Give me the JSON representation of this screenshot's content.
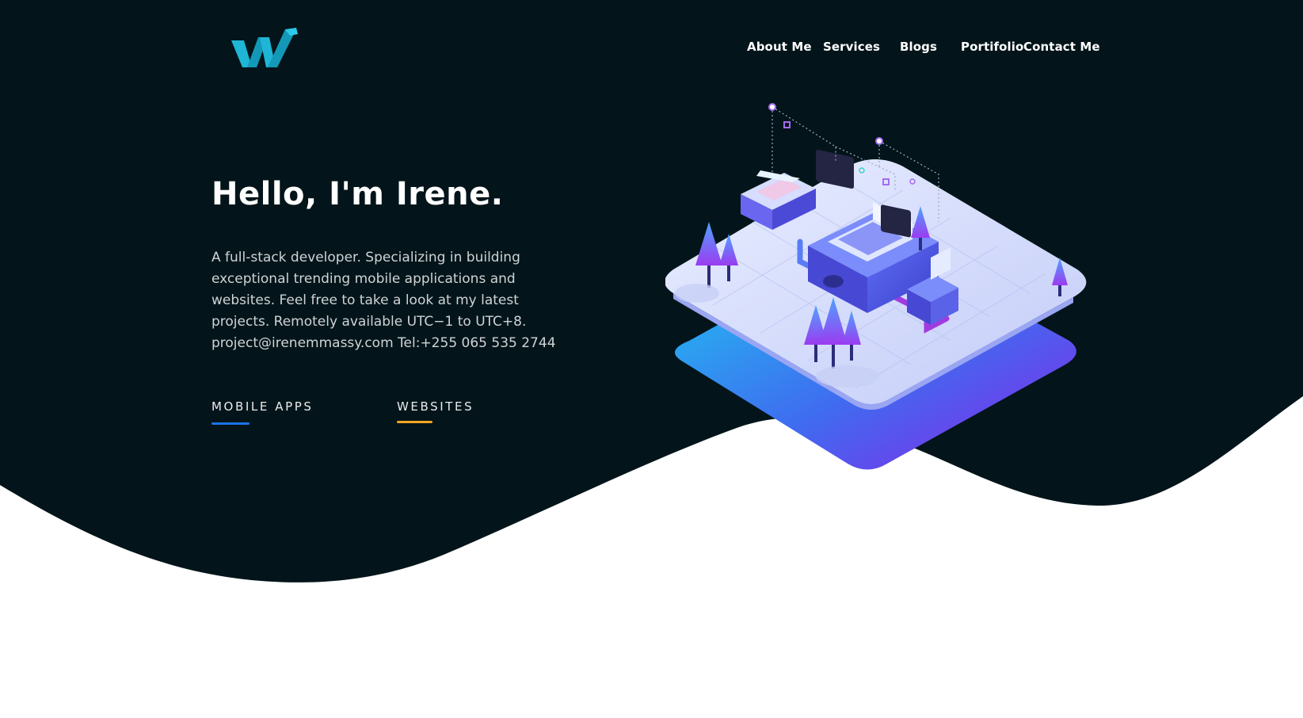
{
  "nav": {
    "items": [
      {
        "label": "About Me"
      },
      {
        "label": "Services"
      },
      {
        "label": "Blogs"
      },
      {
        "label": "Portifolio"
      },
      {
        "label": "Contact Me"
      }
    ]
  },
  "hero": {
    "title": "Hello, I'm Irene.",
    "description_lines": [
      "A full-stack developer. Specializing in building",
      "exceptional trending mobile applications and",
      "websites. Feel free to take a look at my latest",
      "projects. Remotely available UTC−1 to UTC+8.",
      "project@irenemmassy.com Tel:+255 065 535 2744"
    ],
    "cta": {
      "mobile_label": "MOBILE APPS",
      "websites_label": "WEBSITES"
    }
  },
  "colors": {
    "hero_background": "#03151a",
    "page_background": "#ffffff",
    "logo_primary": "#1fb5d6",
    "mobile_underline": "#1a73e8",
    "websites_underline": "#f5a623"
  },
  "icons": {
    "logo": "w-logo-icon"
  }
}
